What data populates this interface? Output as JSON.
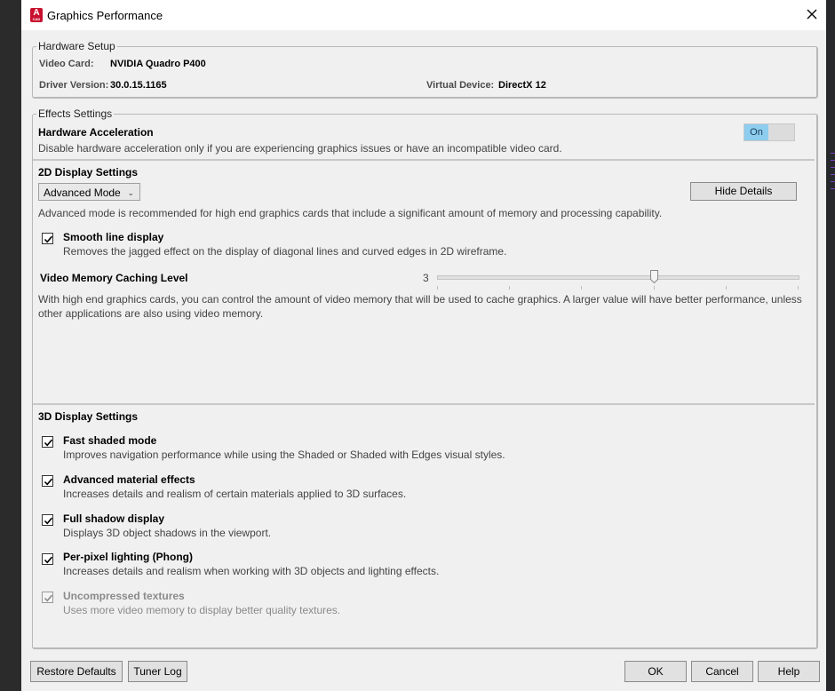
{
  "window": {
    "title": "Graphics Performance",
    "app_icon_letter": "A",
    "app_icon_sub": "CAD"
  },
  "hardware": {
    "legend": "Hardware Setup",
    "video_card_label": "Video Card:",
    "video_card_value": "NVIDIA Quadro P400",
    "driver_label": "Driver Version:",
    "driver_value": "30.0.15.1165",
    "virtual_device_label": "Virtual Device:",
    "virtual_device_value": "DirectX 12"
  },
  "effects": {
    "legend": "Effects Settings",
    "hw_accel_title": "Hardware Acceleration",
    "hw_accel_desc": "Disable hardware acceleration only if you are experiencing graphics issues or have an incompatible video card.",
    "hw_accel_toggle": "On"
  },
  "display2d": {
    "title": "2D Display Settings",
    "mode_selected": "Advanced Mode",
    "hide_details": "Hide Details",
    "mode_desc": "Advanced mode is recommended for high end graphics cards that include a significant amount of memory and processing capability.",
    "smooth_title": "Smooth line display",
    "smooth_desc": "Removes the jagged effect on the display of diagonal lines and curved edges in 2D wireframe.",
    "smooth_checked": true,
    "cache_title": "Video Memory Caching Level",
    "cache_value": "3",
    "cache_level_fraction": 0.6,
    "cache_desc_1": "With high end graphics cards, you can control the amount of video memory that will be used to cache graphics.  A larger value will have better performance, unless",
    "cache_desc_2": "other applications are also using video memory."
  },
  "display3d": {
    "title": "3D Display Settings",
    "items": [
      {
        "title": "Fast shaded mode",
        "desc": "Improves navigation performance while using the Shaded or Shaded with Edges visual styles.",
        "checked": true,
        "enabled": true
      },
      {
        "title": "Advanced material effects",
        "desc": "Increases details and realism of certain materials applied to 3D surfaces.",
        "checked": true,
        "enabled": true
      },
      {
        "title": "Full shadow display",
        "desc": "Displays 3D object shadows in the viewport.",
        "checked": true,
        "enabled": true
      },
      {
        "title": "Per-pixel lighting (Phong)",
        "desc": "Increases details and realism when working with 3D objects and lighting effects.",
        "checked": true,
        "enabled": true
      },
      {
        "title": "Uncompressed textures",
        "desc": "Uses more video memory to display better quality textures.",
        "checked": true,
        "enabled": false
      }
    ]
  },
  "footer": {
    "restore_defaults": "Restore Defaults",
    "tuner_log": "Tuner Log",
    "ok": "OK",
    "cancel": "Cancel",
    "help": "Help"
  },
  "colors": {
    "toggle_on": "#8dcdef",
    "app_icon": "#c8102e",
    "dialog_bg": "#f0f0f0"
  }
}
